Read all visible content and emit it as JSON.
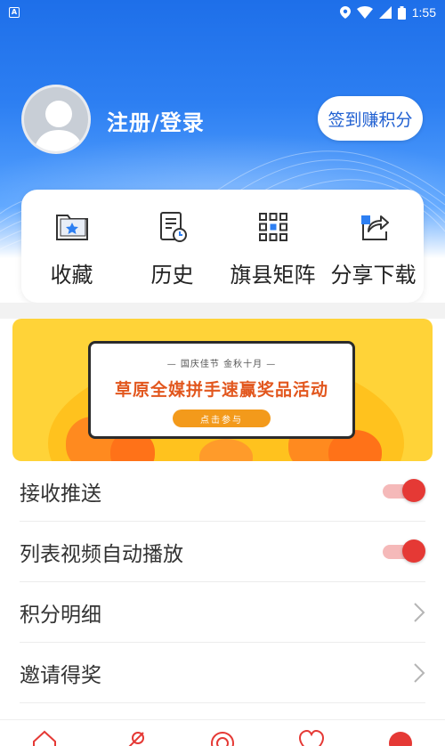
{
  "status_bar": {
    "app_icon": "A",
    "time": "1:55",
    "icons": [
      "location-icon",
      "wifi-icon",
      "signal-icon",
      "battery-icon"
    ]
  },
  "profile": {
    "login_text": "注册/登录",
    "signin_button": "签到赚积分"
  },
  "quick_actions": [
    {
      "label": "收藏",
      "icon": "favorites-folder-icon"
    },
    {
      "label": "历史",
      "icon": "history-doc-icon"
    },
    {
      "label": "旗县矩阵",
      "icon": "grid-matrix-icon"
    },
    {
      "label": "分享下载",
      "icon": "share-icon"
    }
  ],
  "banner": {
    "subtitle": "— 国庆佳节  金秋十月 —",
    "title": "草原全媒拼手速赢奖品活动",
    "button": "点击参与"
  },
  "settings": [
    {
      "label": "接收推送",
      "control": "toggle",
      "on": true
    },
    {
      "label": "列表视频自动播放",
      "control": "toggle",
      "on": true
    },
    {
      "label": "积分明细",
      "control": "chevron"
    },
    {
      "label": "邀请得奖",
      "control": "chevron"
    }
  ],
  "colors": {
    "header_blue": "#2d7ff2",
    "toggle_red": "#e53935",
    "banner_yellow": "#ffd338",
    "banner_title_orange": "#e2571e"
  },
  "bottom_nav": [
    "home-icon",
    "radar-icon",
    "target-icon",
    "heart-icon",
    "profile-dot-icon"
  ]
}
